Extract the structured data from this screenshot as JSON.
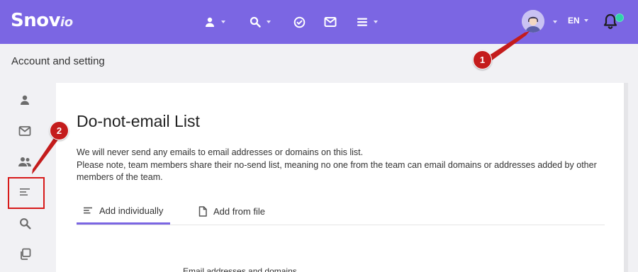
{
  "app": {
    "logo_main": "Snov",
    "logo_suffix": "io",
    "language": "EN",
    "colors": {
      "brand": "#7b66e3",
      "notification": "#2ed3a7",
      "annotation": "#c41c1c"
    }
  },
  "nav": {
    "icons": [
      "person-icon",
      "search-icon",
      "check-circle-icon",
      "mail-icon",
      "menu-icon"
    ]
  },
  "page": {
    "title": "Account and setting"
  },
  "sidebar": {
    "icons": [
      "person-icon",
      "mail-icon",
      "team-icon",
      "list-icon",
      "search-icon",
      "copy-icon"
    ]
  },
  "annotations": {
    "marker1": "1",
    "marker2": "2"
  },
  "card": {
    "title": "Do-not-email List",
    "line1": "We will never send any emails to email addresses or domains on this list.",
    "line2": "Please note, team members share their no-send list, meaning no one from the team can email domains or addresses added by other members of the team.",
    "tabs": [
      {
        "label": "Add individually",
        "icon": "list-icon",
        "active": true
      },
      {
        "label": "Add from file",
        "icon": "file-icon",
        "active": false
      }
    ],
    "field_label": "Email addresses and domains"
  }
}
